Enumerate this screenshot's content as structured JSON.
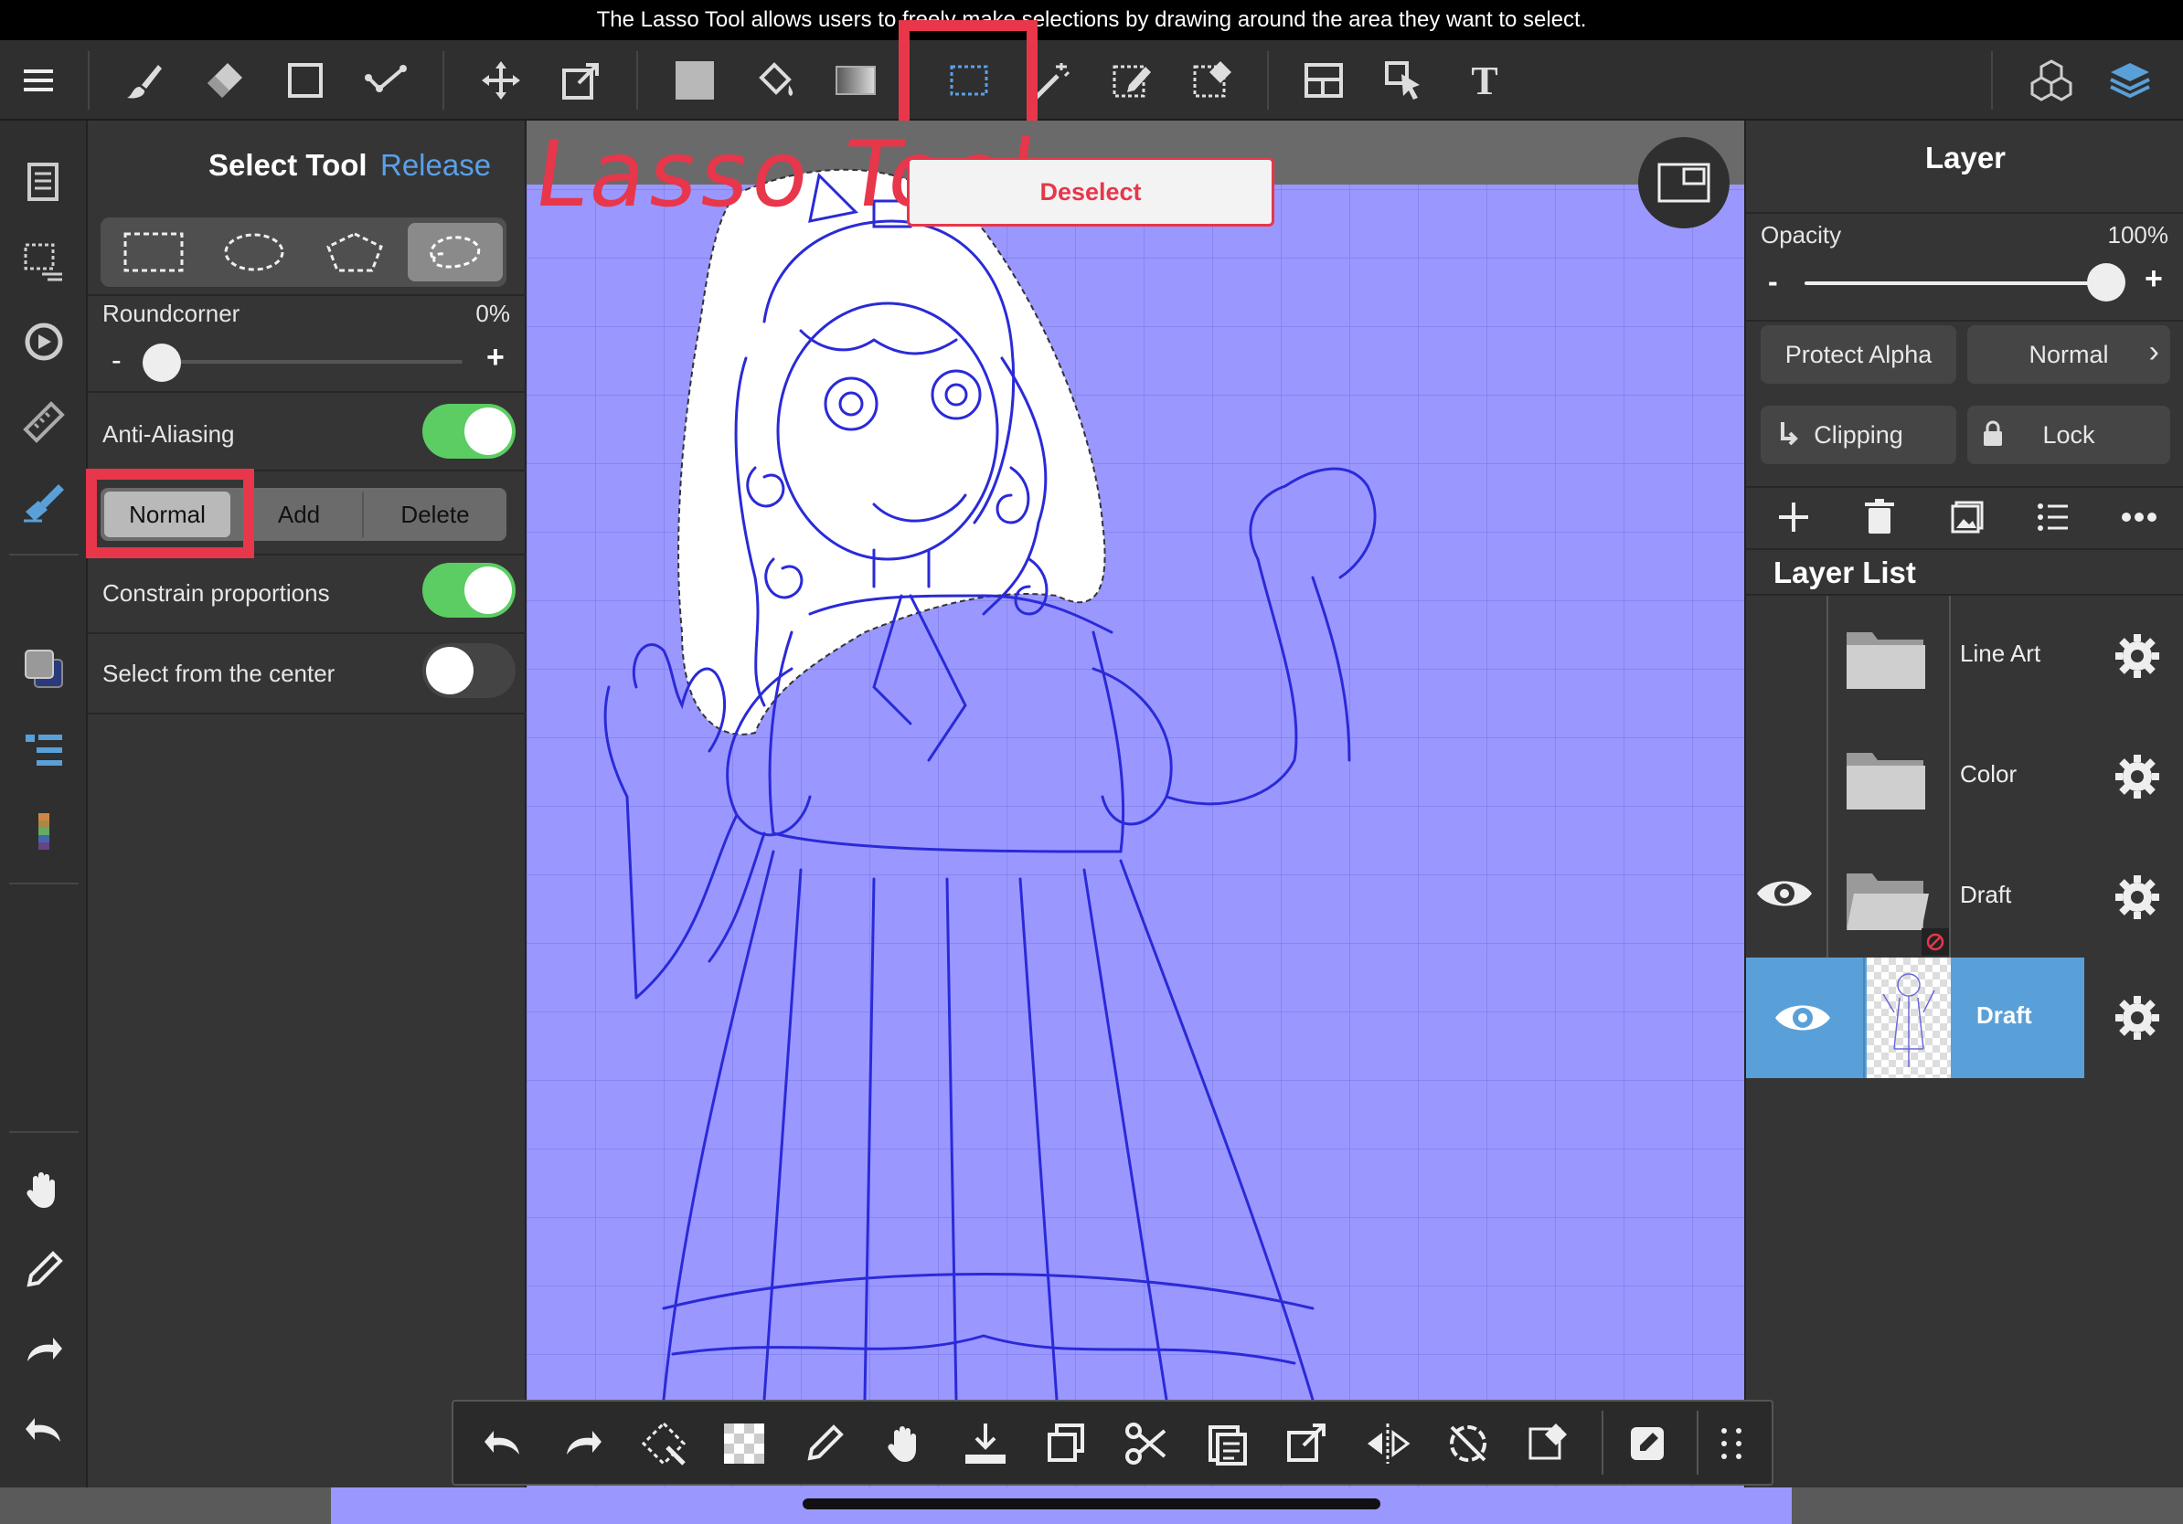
{
  "caption": "The Lasso Tool allows users to freely make selections by drawing around the area they want to select.",
  "annotation": {
    "text": "Lasso Tool",
    "color": "#e8364b"
  },
  "deselect_label": "Deselect",
  "tool_panel": {
    "title": "Select Tool",
    "release": "Release",
    "roundcorner_label": "Roundcorner",
    "roundcorner_value": "0%",
    "roundcorner_fraction": 0,
    "minus": "-",
    "plus": "+",
    "anti_aliasing_label": "Anti-Aliasing",
    "anti_aliasing_on": true,
    "modes": [
      "Normal",
      "Add",
      "Delete"
    ],
    "selected_mode": "Normal",
    "constrain_label": "Constrain proportions",
    "constrain_on": true,
    "center_label": "Select from the center",
    "center_on": false,
    "shape_icons": [
      "rectangle-select-icon",
      "ellipse-select-icon",
      "polygon-select-icon",
      "lasso-select-icon"
    ],
    "selected_shape": "lasso-select-icon"
  },
  "layer_panel": {
    "title": "Layer",
    "opacity_label": "Opacity",
    "opacity_value": "100%",
    "opacity_fraction": 1,
    "minus": "-",
    "plus": "+",
    "protect_alpha": "Protect Alpha",
    "blend_mode": "Normal",
    "clipping": "Clipping",
    "lock": "Lock",
    "list_title": "Layer List",
    "layers": [
      {
        "name": "Line Art",
        "type": "folder",
        "visible": false,
        "selected": false
      },
      {
        "name": "Color",
        "type": "folder",
        "visible": false,
        "selected": false
      },
      {
        "name": "Draft",
        "type": "folder",
        "visible": true,
        "selected": false
      },
      {
        "name": "Draft",
        "type": "layer",
        "visible": true,
        "selected": true
      }
    ]
  },
  "colors": {
    "accent_blue": "#5aa0d8",
    "release_blue": "#5aa0e8",
    "toggle_green": "#5ccd63",
    "highlight_red": "#e8364b",
    "canvas": "#9a98ff",
    "sketch": "#2a2ad8"
  }
}
